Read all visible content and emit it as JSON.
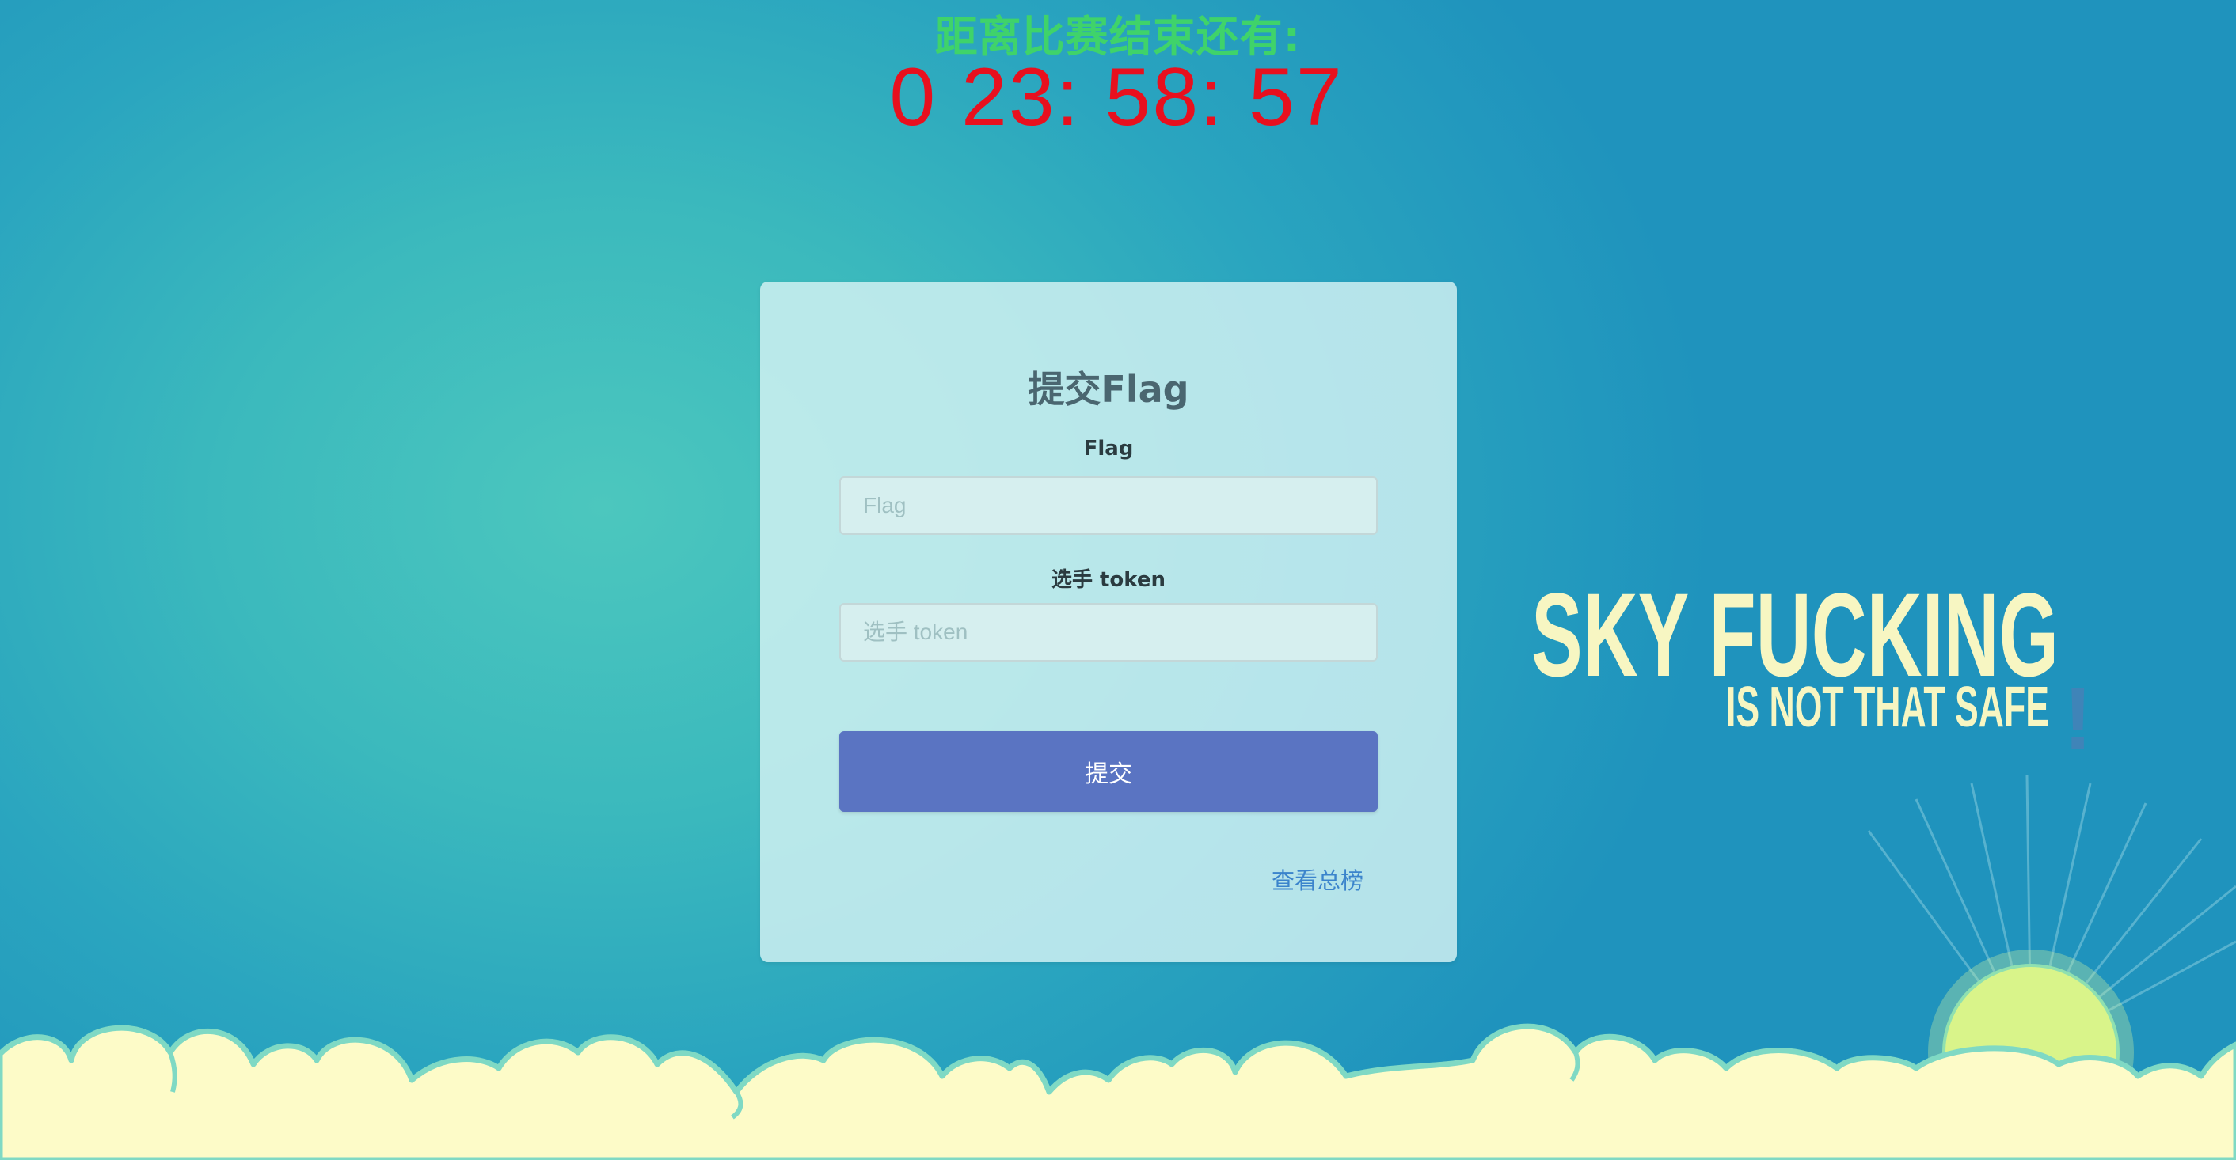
{
  "countdown": {
    "label": "距离比赛结束还有:",
    "value": "0 23: 58: 57"
  },
  "form": {
    "title": "提交Flag",
    "flag_label": "Flag",
    "flag_placeholder": "Flag",
    "token_label": "选手 token",
    "token_placeholder": "选手 token",
    "submit_label": "提交",
    "rank_link": "查看总榜"
  },
  "slogan": {
    "line1": "SKY FUCKING",
    "line2": "IS NOT THAT SAFE",
    "mark": "!"
  },
  "colors": {
    "countdown_label": "#3fd36a",
    "countdown_value": "#e8101e",
    "button": "#5a74c2",
    "link": "#3b84cc",
    "cloud": "#fdfbc8",
    "cloud_outline": "#7fd9c4",
    "sun": "#d9f48a"
  },
  "icons": [
    "sun-icon",
    "clouds-decoration"
  ]
}
